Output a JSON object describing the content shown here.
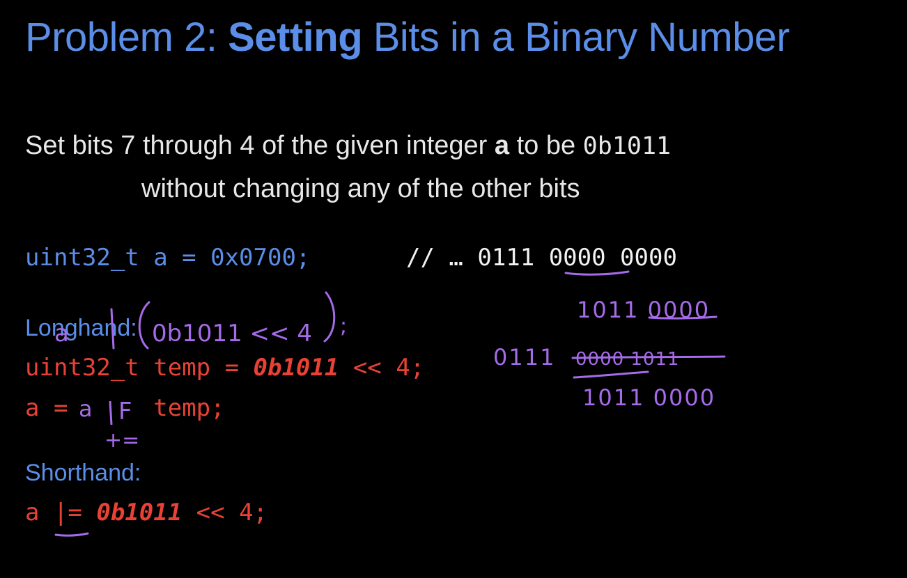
{
  "slide": {
    "title_prefix": "Problem 2: ",
    "title_bold": "Setting",
    "title_suffix": " Bits in a Binary Number",
    "desc_line1_pre": "Set bits 7 through 4 of the given integer ",
    "desc_line1_var": "a",
    "desc_line1_mid": " to be ",
    "desc_line1_code": "0b1011",
    "desc_line2": "without changing any of the other bits",
    "decl_code": "uint32_t a = 0x0700;",
    "decl_comment": "// … 0111 0000 0000",
    "longhand_label": "Longhand:",
    "longhand_line1_pre": "uint32_t temp = ",
    "longhand_line1_lit": "0b1011",
    "longhand_line1_post": " << 4;",
    "longhand_line2": "a =      temp;",
    "shorthand_label": "Shorthand:",
    "shorthand_pre": "a |= ",
    "shorthand_lit": "0b1011",
    "shorthand_post": " << 4;"
  },
  "annotations": {
    "over_label": "a | (0b1011 << 4);",
    "op_left": "a",
    "op_or": "F",
    "op_plus_eq": "+=",
    "bits_row1": "1011 0000",
    "bits_row2_left": "0111",
    "bits_row2_strike": "0000 1011",
    "bits_row3": "1011 0000"
  },
  "colors": {
    "background": "#000000",
    "title": "#5b8ee8",
    "text": "#e8e8e8",
    "keyword_blue": "#5b8ee8",
    "code_red": "#e94235",
    "ink_purple": "#a56be8"
  }
}
